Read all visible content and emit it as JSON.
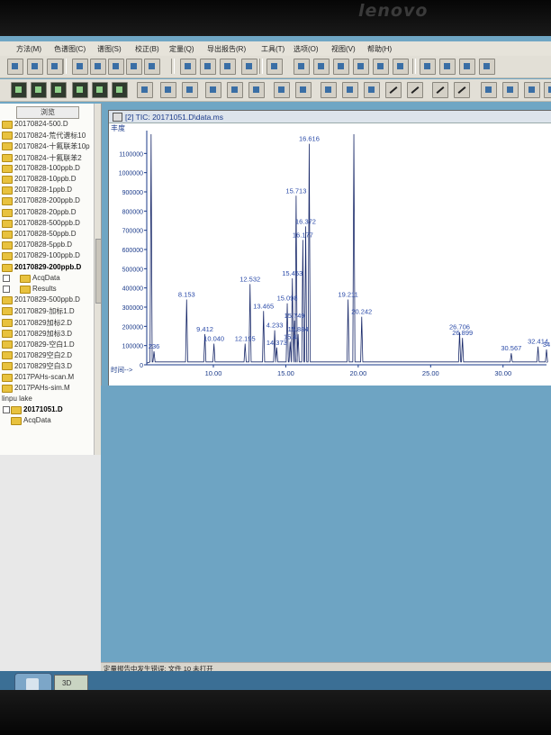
{
  "brand": "lenovo",
  "menu": [
    "方法(M)",
    "色谱图(C)",
    "谱图(S)",
    "校正(B)",
    "定量(Q)",
    "导出报告(R)",
    "工具(T)",
    "选项(O)",
    "视图(V)",
    "帮助(H)"
  ],
  "browse_label": "浏览",
  "files": [
    {
      "name": "20170824-500.D",
      "indent": 0,
      "bold": false
    },
    {
      "name": "20170824-荒代谱标10",
      "indent": 0,
      "bold": false
    },
    {
      "name": "20170824-十氟联苯10p",
      "indent": 0,
      "bold": false
    },
    {
      "name": "20170824-十氟联苯2",
      "indent": 0,
      "bold": false
    },
    {
      "name": "20170828-100ppb.D",
      "indent": 0,
      "bold": false
    },
    {
      "name": "20170828-10ppb.D",
      "indent": 0,
      "bold": false
    },
    {
      "name": "20170828-1ppb.D",
      "indent": 0,
      "bold": false
    },
    {
      "name": "20170828-200ppb.D",
      "indent": 0,
      "bold": false
    },
    {
      "name": "20170828-20ppb.D",
      "indent": 0,
      "bold": false
    },
    {
      "name": "20170828-500ppb.D",
      "indent": 0,
      "bold": false
    },
    {
      "name": "20170828-50ppb.D",
      "indent": 0,
      "bold": false
    },
    {
      "name": "20170828-5ppb.D",
      "indent": 0,
      "bold": false
    },
    {
      "name": "20170829-100ppb.D",
      "indent": 0,
      "bold": false
    },
    {
      "name": "20170829-200ppb.D",
      "indent": 0,
      "bold": true
    },
    {
      "name": "AcqData",
      "indent": 1,
      "bold": false,
      "pm": "+"
    },
    {
      "name": "Results",
      "indent": 1,
      "bold": false,
      "pm": "+"
    },
    {
      "name": "20170829-500ppb.D",
      "indent": 0,
      "bold": false
    },
    {
      "name": "20170829-加标1.D",
      "indent": 0,
      "bold": false
    },
    {
      "name": "20170829加标2.D",
      "indent": 0,
      "bold": false
    },
    {
      "name": "20170829加标3.D",
      "indent": 0,
      "bold": false
    },
    {
      "name": "20170829-空白1.D",
      "indent": 0,
      "bold": false
    },
    {
      "name": "20170829空白2.D",
      "indent": 0,
      "bold": false
    },
    {
      "name": "20170829空白3.D",
      "indent": 0,
      "bold": false
    },
    {
      "name": "2017PAHs-scan.M",
      "indent": 0,
      "bold": false
    },
    {
      "name": "2017PAHs-sim.M",
      "indent": 0,
      "bold": false
    },
    {
      "name": "linpu lake",
      "indent": 0,
      "bold": false,
      "nofolder": true
    },
    {
      "name": "20171051.D",
      "indent": 0,
      "bold": true,
      "pm": "-"
    },
    {
      "name": "AcqData",
      "indent": 1,
      "bold": false
    }
  ],
  "chart_window": {
    "title": "[2] TIC: 20171051.D\\data.ms"
  },
  "status_text": "定量报告中发生错误: 文件 10 未打开",
  "taskbar_app_label": "3D",
  "chart_data": {
    "type": "line",
    "ylabel": "丰度",
    "xlabel": "时间-->",
    "xlim": [
      5.4,
      33.0
    ],
    "ylim": [
      0,
      1200000
    ],
    "yticks": [
      0,
      100000,
      200000,
      300000,
      400000,
      500000,
      600000,
      700000,
      800000,
      900000,
      1000000,
      1100000
    ],
    "xticks": [
      10.0,
      15.0,
      20.0,
      25.0,
      30.0
    ],
    "xtick_labels": [
      "10.00",
      "15.00",
      "20.00",
      "25.00",
      "30.00"
    ],
    "peaks": [
      {
        "rt": 5.7,
        "height": 1200000,
        "label": ""
      },
      {
        "rt": 5.9,
        "height": 70000,
        "label": "236"
      },
      {
        "rt": 8.153,
        "height": 340000,
        "label": "8.153"
      },
      {
        "rt": 9.412,
        "height": 160000,
        "label": "9.412"
      },
      {
        "rt": 10.04,
        "height": 110000,
        "label": "10.040"
      },
      {
        "rt": 12.19,
        "height": 110000,
        "label": "12.195"
      },
      {
        "rt": 12.532,
        "height": 420000,
        "label": "12.532"
      },
      {
        "rt": 13.465,
        "height": 280000,
        "label": "13.465"
      },
      {
        "rt": 14.233,
        "height": 180000,
        "label": "4.233"
      },
      {
        "rt": 14.373,
        "height": 90000,
        "label": "14.373"
      },
      {
        "rt": 15.1,
        "height": 320000,
        "label": "15.098"
      },
      {
        "rt": 15.3,
        "height": 120000,
        "label": "15.4"
      },
      {
        "rt": 15.453,
        "height": 450000,
        "label": "15.453"
      },
      {
        "rt": 15.6,
        "height": 230000,
        "label": "15.749"
      },
      {
        "rt": 15.713,
        "height": 880000,
        "label": "15.713"
      },
      {
        "rt": 15.85,
        "height": 160000,
        "label": "15.884"
      },
      {
        "rt": 16.177,
        "height": 650000,
        "label": "16.177"
      },
      {
        "rt": 16.372,
        "height": 720000,
        "label": "16.372"
      },
      {
        "rt": 16.616,
        "height": 1150000,
        "label": "16.616"
      },
      {
        "rt": 19.3,
        "height": 340000,
        "label": "19.211"
      },
      {
        "rt": 19.7,
        "height": 1200000,
        "label": ""
      },
      {
        "rt": 20.242,
        "height": 250000,
        "label": "20.242"
      },
      {
        "rt": 27.0,
        "height": 170000,
        "label": "26.706"
      },
      {
        "rt": 27.2,
        "height": 140000,
        "label": "26.899"
      },
      {
        "rt": 30.567,
        "height": 60000,
        "label": "30.567"
      },
      {
        "rt": 32.414,
        "height": 95000,
        "label": "32.414"
      },
      {
        "rt": 33.0,
        "height": 80000,
        "label": "34"
      }
    ]
  }
}
